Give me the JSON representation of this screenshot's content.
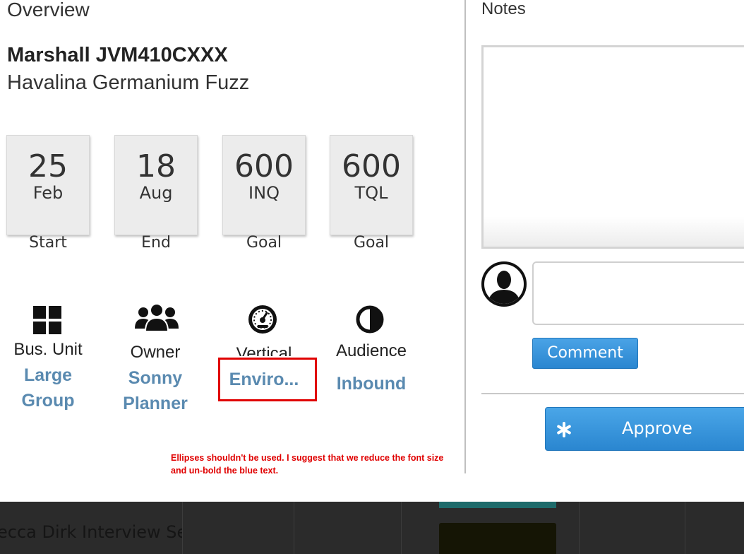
{
  "overview": {
    "title": "Overview",
    "product_name": "Marshall JVM410CXXX",
    "product_sub": "Havalina Germanium Fuzz"
  },
  "cards": [
    {
      "big": "25",
      "small": "Feb",
      "label": "Start"
    },
    {
      "big": "18",
      "small": "Aug",
      "label": "End"
    },
    {
      "big": "600",
      "small": "INQ",
      "label": "Goal"
    },
    {
      "big": "600",
      "small": "TQL",
      "label": "Goal"
    }
  ],
  "meta": {
    "bus_unit": {
      "icon": "grid-icon",
      "label": "Bus. Unit",
      "value_line1": "Large",
      "value_line2": "Group"
    },
    "owner": {
      "icon": "people-group-icon",
      "label": "Owner",
      "value_line1": "Sonny",
      "value_line2": "Planner"
    },
    "vertical": {
      "icon": "speedometer-icon",
      "label": "Vertical",
      "value": "Enviro..."
    },
    "audience": {
      "icon": "contrast-icon",
      "label": "Audience",
      "value": "Inbound"
    }
  },
  "annotation": {
    "line1": "Ellipses shouldn't be used. I suggest that we reduce the font size",
    "line2": "and un-bold the blue text.",
    "color": "#e00000"
  },
  "notes": {
    "title": "Notes",
    "notes_value": "",
    "comment_value": "",
    "comment_button": "Comment",
    "approve_button": "Approve",
    "button_color": "#2a86d0"
  },
  "background": {
    "row_text": "ecca Dirk Interview Ses"
  }
}
